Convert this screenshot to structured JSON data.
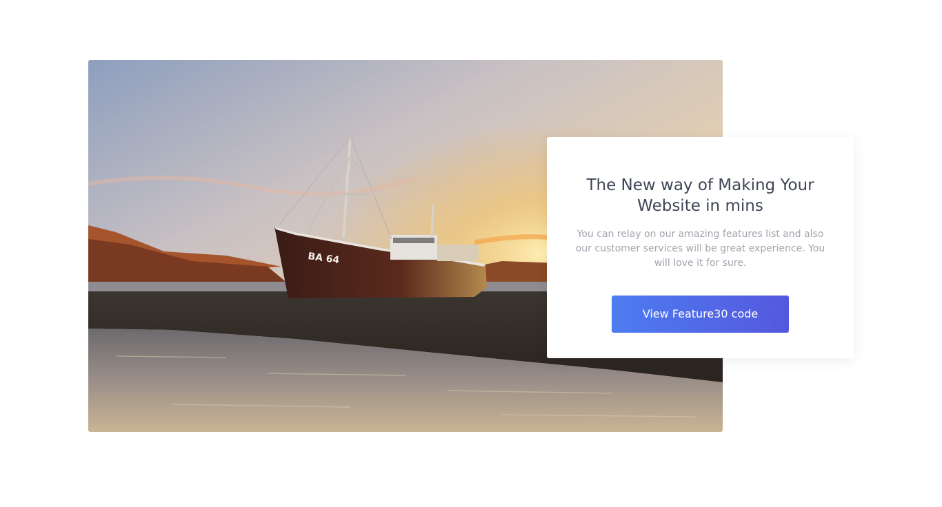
{
  "photo": {
    "alt": "Rusty fishing boat on a beach at sunset",
    "hull_marking": "BA 64"
  },
  "card": {
    "title": "The New way of Making Your Website in mins",
    "description": "You can relay on our amazing features list and also our customer services will be great experience. You will love it for sure.",
    "button_label": "View Feature30 code"
  },
  "colors": {
    "title": "#3e4555",
    "text": "#a0a4ad",
    "button_start": "#4d7cf1",
    "button_end": "#5558de"
  }
}
